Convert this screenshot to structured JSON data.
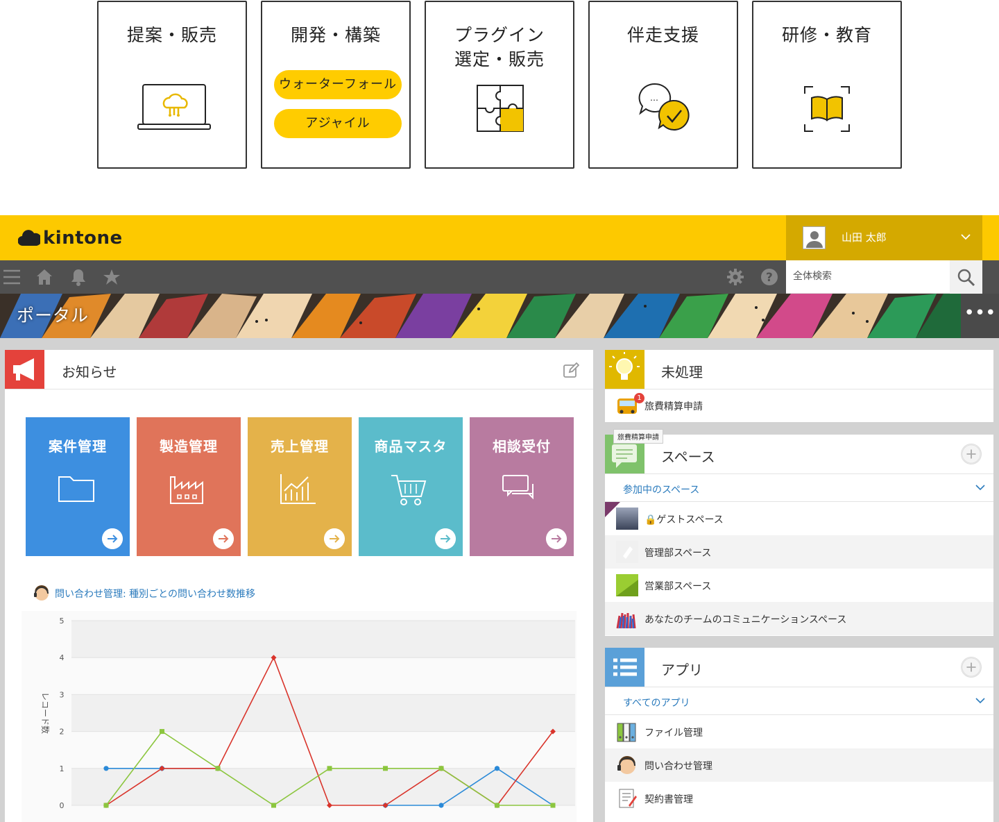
{
  "services": [
    {
      "title": "提案・販売",
      "icon": "laptop-cloud-icon"
    },
    {
      "title": "開発・構築",
      "buttons": [
        "ウォーターフォール",
        "アジャイル"
      ]
    },
    {
      "title_lines": [
        "プラグイン",
        "選定・販売"
      ],
      "icon": "puzzle-icon"
    },
    {
      "title": "伴走支援",
      "icon": "chat-check-icon"
    },
    {
      "title": "研修・教育",
      "icon": "book-icon"
    }
  ],
  "header": {
    "logo": "kintone",
    "user_name": "山田 太郎",
    "search_placeholder": "全体検索"
  },
  "banner": {
    "title": "ポータル",
    "more": "•••"
  },
  "notice": {
    "title": "お知らせ",
    "tiles": [
      {
        "label": "案件管理",
        "color": "#3d8fe0",
        "icon": "folder-icon"
      },
      {
        "label": "製造管理",
        "color": "#e0745a",
        "icon": "factory-icon"
      },
      {
        "label": "売上管理",
        "color": "#e4b24a",
        "icon": "chart-icon"
      },
      {
        "label": "商品マスタ",
        "color": "#5bbccb",
        "icon": "cart-icon"
      },
      {
        "label": "相談受付",
        "color": "#b87ba0",
        "icon": "chat-icon"
      }
    ]
  },
  "chart_data": {
    "type": "line",
    "title": "問い合わせ管理: 種別ごとの問い合わせ数推移",
    "xlabel": "",
    "ylabel": "レコード数",
    "ylim": [
      0,
      5
    ],
    "yticks": [
      "0",
      "1",
      "2",
      "3",
      "4",
      "5"
    ],
    "x": [
      0,
      1,
      2,
      3,
      4,
      5,
      6,
      7,
      8
    ],
    "series": [
      {
        "color": "#2b8ad8",
        "values": [
          1,
          1,
          1,
          null,
          null,
          0,
          0,
          1,
          0
        ]
      },
      {
        "color": "#d9342b",
        "values": [
          0,
          1,
          1,
          4,
          0,
          0,
          1,
          0,
          2
        ]
      },
      {
        "color": "#8cc63f",
        "values": [
          0,
          2,
          1,
          0,
          1,
          1,
          1,
          0,
          0
        ]
      }
    ]
  },
  "pending": {
    "title": "未処理",
    "items": [
      {
        "label": "旅費精算申請",
        "badge": "1",
        "tooltip": "旅費精算申請"
      }
    ]
  },
  "spaces": {
    "title": "スペース",
    "sub_label": "参加中のスペース",
    "items": [
      {
        "label": "🔒ゲストスペース"
      },
      {
        "label": "管理部スペース"
      },
      {
        "label": "営業部スペース"
      },
      {
        "label": "あなたのチームのコミュニケーションスペース"
      }
    ]
  },
  "apps": {
    "title": "アプリ",
    "sub_label": "すべてのアプリ",
    "items": [
      {
        "label": "ファイル管理"
      },
      {
        "label": "問い合わせ管理"
      },
      {
        "label": "契約書管理"
      }
    ]
  }
}
